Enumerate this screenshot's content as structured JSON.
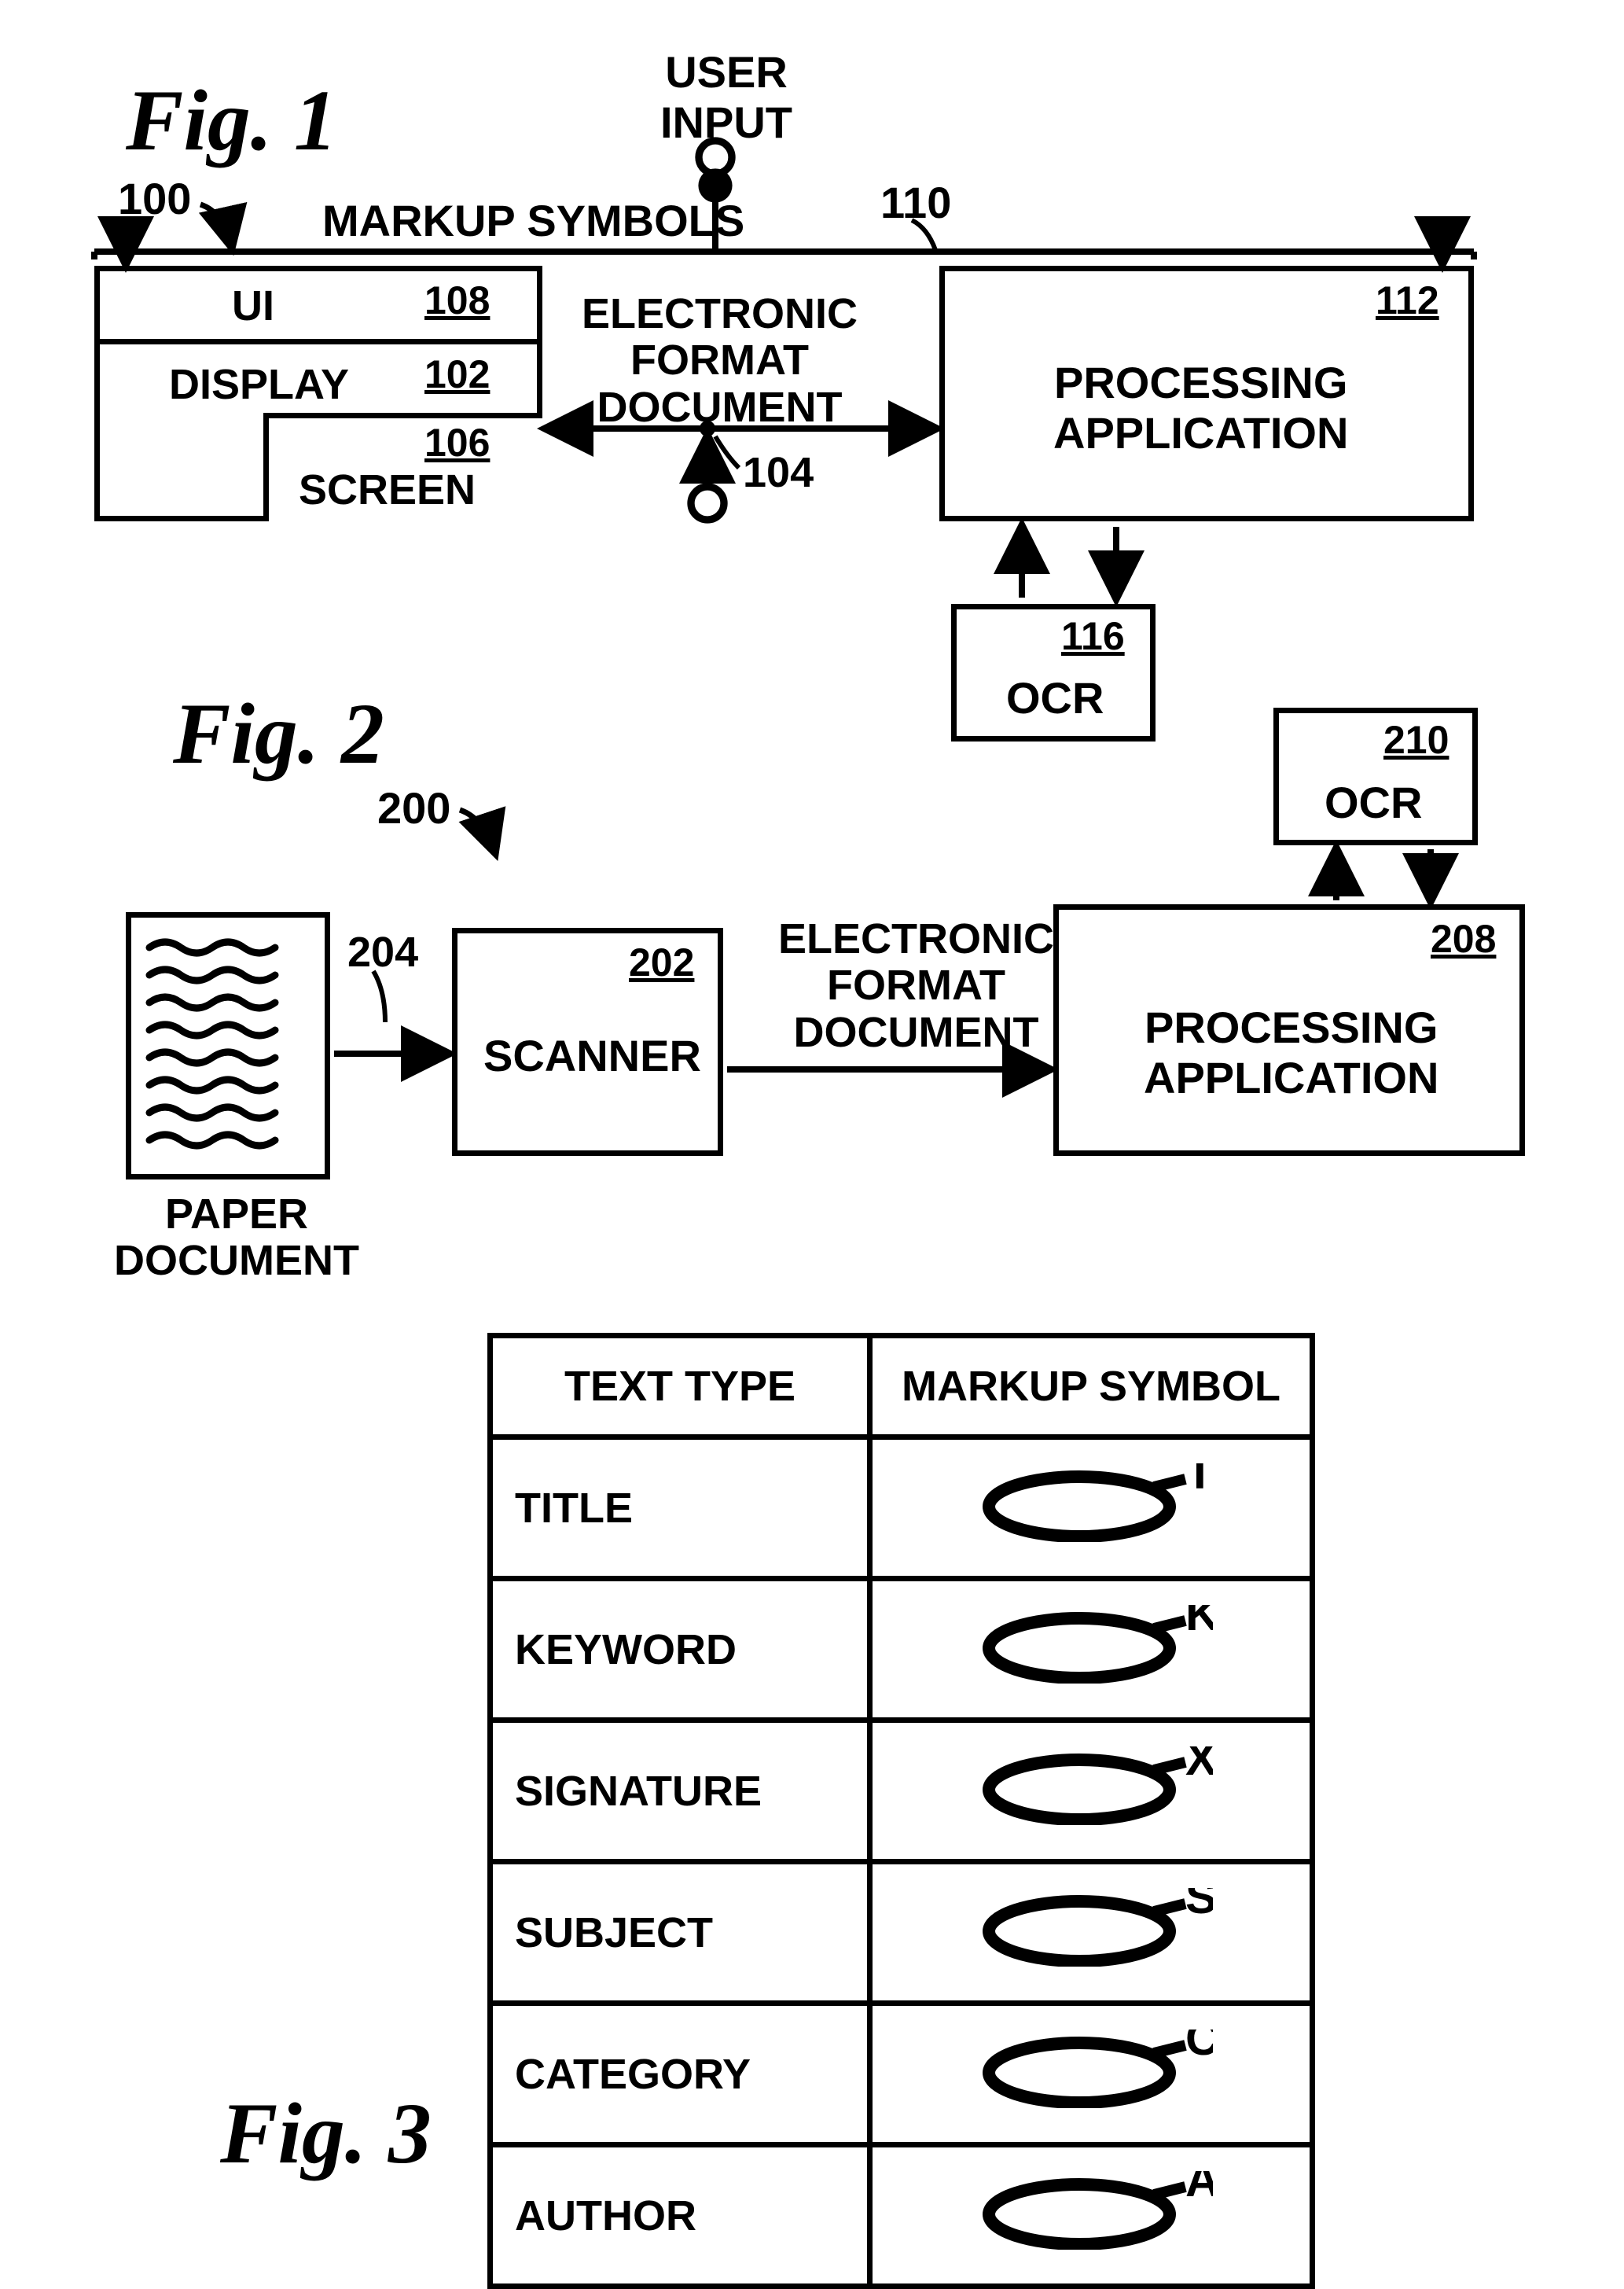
{
  "fig1": {
    "title": "Fig. 1",
    "ref_100": "100",
    "user_input": "USER\nINPUT",
    "markup_symbols": "MARKUP SYMBOLS",
    "ref_110": "110",
    "ui": "UI",
    "ref_108": "108",
    "display": "DISPLAY",
    "ref_102": "102",
    "screen": "SCREEN",
    "ref_106": "106",
    "efd": "ELECTRONIC\nFORMAT\nDOCUMENT",
    "ref_104": "104",
    "proc_app": "PROCESSING\nAPPLICATION",
    "ref_112": "112",
    "ocr": "OCR",
    "ref_116": "116"
  },
  "fig2": {
    "title": "Fig. 2",
    "ref_200": "200",
    "paper_doc": "PAPER\nDOCUMENT",
    "ref_204": "204",
    "scanner": "SCANNER",
    "ref_202": "202",
    "efd": "ELECTRONIC\nFORMAT\nDOCUMENT",
    "proc_app": "PROCESSING\nAPPLICATION",
    "ref_208": "208",
    "ocr": "OCR",
    "ref_210": "210"
  },
  "fig3": {
    "title": "Fig. 3",
    "header_type": "TEXT TYPE",
    "header_symbol": "MARKUP SYMBOL",
    "rows": [
      {
        "type": "TITLE",
        "letter": "T"
      },
      {
        "type": "KEYWORD",
        "letter": "K"
      },
      {
        "type": "SIGNATURE",
        "letter": "X"
      },
      {
        "type": "SUBJECT",
        "letter": "S"
      },
      {
        "type": "CATEGORY",
        "letter": "C"
      },
      {
        "type": "AUTHOR",
        "letter": "A"
      }
    ]
  }
}
